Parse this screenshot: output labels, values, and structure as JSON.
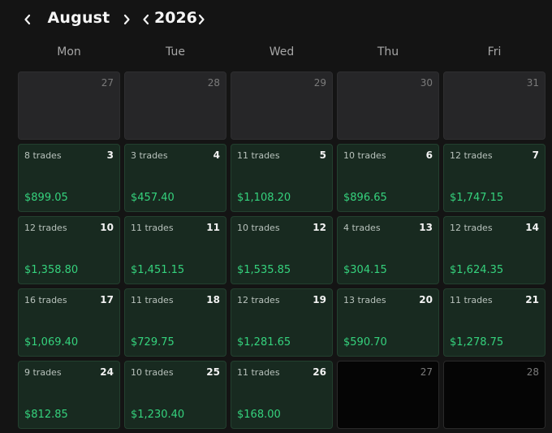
{
  "header": {
    "month": "August",
    "year": "2026"
  },
  "weekdays": [
    "Mon",
    "Tue",
    "Wed",
    "Thu",
    "Fri"
  ],
  "weeks": [
    [
      {
        "day": "27",
        "trades": "",
        "pnl": "",
        "kind": "outside"
      },
      {
        "day": "28",
        "trades": "",
        "pnl": "",
        "kind": "outside"
      },
      {
        "day": "29",
        "trades": "",
        "pnl": "",
        "kind": "outside"
      },
      {
        "day": "30",
        "trades": "",
        "pnl": "",
        "kind": "outside"
      },
      {
        "day": "31",
        "trades": "",
        "pnl": "",
        "kind": "outside"
      }
    ],
    [
      {
        "day": "3",
        "trades": "8 trades",
        "pnl": "$899.05",
        "kind": "trade"
      },
      {
        "day": "4",
        "trades": "3 trades",
        "pnl": "$457.40",
        "kind": "trade"
      },
      {
        "day": "5",
        "trades": "11 trades",
        "pnl": "$1,108.20",
        "kind": "trade"
      },
      {
        "day": "6",
        "trades": "10 trades",
        "pnl": "$896.65",
        "kind": "trade"
      },
      {
        "day": "7",
        "trades": "12 trades",
        "pnl": "$1,747.15",
        "kind": "trade"
      }
    ],
    [
      {
        "day": "10",
        "trades": "12 trades",
        "pnl": "$1,358.80",
        "kind": "trade"
      },
      {
        "day": "11",
        "trades": "11 trades",
        "pnl": "$1,451.15",
        "kind": "trade"
      },
      {
        "day": "12",
        "trades": "10 trades",
        "pnl": "$1,535.85",
        "kind": "trade"
      },
      {
        "day": "13",
        "trades": "4 trades",
        "pnl": "$304.15",
        "kind": "trade"
      },
      {
        "day": "14",
        "trades": "12 trades",
        "pnl": "$1,624.35",
        "kind": "trade"
      }
    ],
    [
      {
        "day": "17",
        "trades": "16 trades",
        "pnl": "$1,069.40",
        "kind": "trade"
      },
      {
        "day": "18",
        "trades": "11 trades",
        "pnl": "$729.75",
        "kind": "trade"
      },
      {
        "day": "19",
        "trades": "12 trades",
        "pnl": "$1,281.65",
        "kind": "trade"
      },
      {
        "day": "20",
        "trades": "13 trades",
        "pnl": "$590.70",
        "kind": "trade"
      },
      {
        "day": "21",
        "trades": "11 trades",
        "pnl": "$1,278.75",
        "kind": "trade"
      }
    ],
    [
      {
        "day": "24",
        "trades": "9 trades",
        "pnl": "$812.85",
        "kind": "trade"
      },
      {
        "day": "25",
        "trades": "10 trades",
        "pnl": "$1,230.40",
        "kind": "trade"
      },
      {
        "day": "26",
        "trades": "11 trades",
        "pnl": "$168.00",
        "kind": "trade"
      },
      {
        "day": "27",
        "trades": "",
        "pnl": "",
        "kind": "empty"
      },
      {
        "day": "28",
        "trades": "",
        "pnl": "",
        "kind": "empty"
      }
    ]
  ],
  "colors": {
    "background": "#141414",
    "trade_cell": "#182a20",
    "outside_cell": "#262628",
    "empty_cell": "#050505",
    "profit_text": "#35d27d"
  },
  "icons": {
    "prev": "chevron-left-icon",
    "next": "chevron-right-icon"
  }
}
